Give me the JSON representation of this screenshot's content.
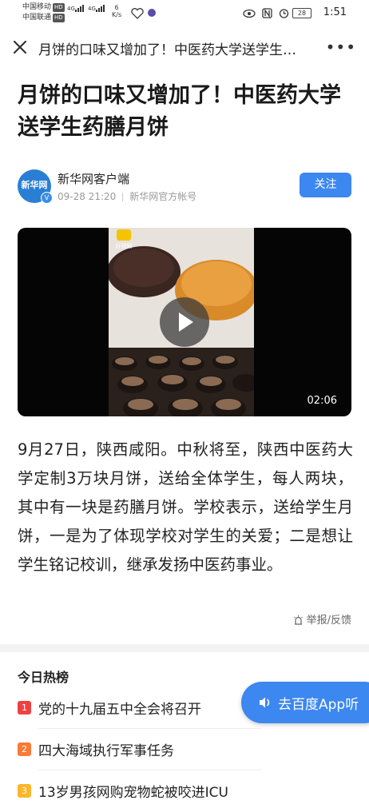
{
  "status_bar": {
    "carrier1": "中国移动",
    "carrier2": "中国联通",
    "hd": "HD",
    "net": "4G",
    "speed_value": "6",
    "speed_unit": "K/s",
    "battery": "28",
    "time": "1:51"
  },
  "nav": {
    "title": "月饼的口味又增加了！中医药大学送学生…",
    "more": "•••"
  },
  "article": {
    "headline": "月饼的口味又增加了！中医药大学送学生药膳月饼",
    "author": {
      "avatar_text": "新华网",
      "name": "新华网客户端",
      "date": "09-28 21:20",
      "account": "新华网官方帐号",
      "follow_label": "关注"
    },
    "video": {
      "duration": "02:06",
      "watermark": "好视频"
    },
    "body": "9月27日，陕西咸阳。中秋将至，陕西中医药大学定制3万块月饼，送给全体学生，每人两块，其中有一块是药膳月饼。学校表示，送给学生月饼，一是为了体现学校对学生的关爱；二是想让学生铭记校训，继承发扬中医药事业。",
    "report_label": "举报/反馈"
  },
  "hot_list": {
    "title": "今日热榜",
    "items": [
      {
        "rank": "1",
        "text": "党的十九届五中全会将召开",
        "color": "#f04142"
      },
      {
        "rank": "2",
        "text": "四大海域执行军事任务",
        "color": "#fa7a36"
      },
      {
        "rank": "3",
        "text": "13岁男孩网购宠物蛇被咬进ICU",
        "color": "#fbb62a"
      }
    ]
  },
  "app_button": {
    "label": "去百度App听"
  },
  "colors": {
    "accent": "#3c87f0"
  }
}
